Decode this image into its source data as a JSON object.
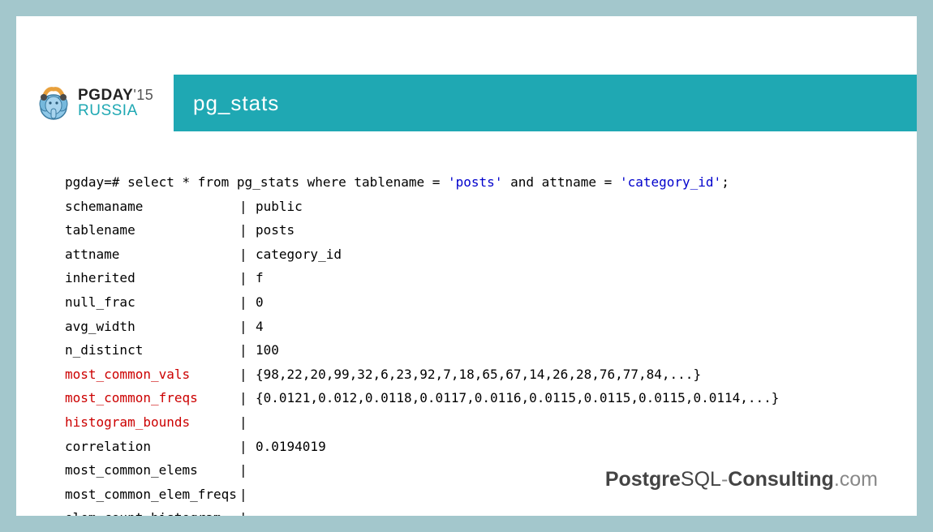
{
  "logo": {
    "line1_main": "PGDAY",
    "line1_sup": "'15",
    "line2": "RUSSIA"
  },
  "title": "pg_stats",
  "query": {
    "prefix": "pgday=# ",
    "body1": "select * from pg_stats where tablename = ",
    "lit1": "'posts'",
    "body2": " and attname = ",
    "lit2": "'category_id'",
    "tail": ";"
  },
  "rows": [
    {
      "k": "schemaname",
      "v": "public",
      "red": false
    },
    {
      "k": "tablename",
      "v": "posts",
      "red": false
    },
    {
      "k": "attname",
      "v": "category_id",
      "red": false
    },
    {
      "k": "inherited",
      "v": "f",
      "red": false
    },
    {
      "k": "null_frac",
      "v": "0",
      "red": false
    },
    {
      "k": "avg_width",
      "v": "4",
      "red": false
    },
    {
      "k": "n_distinct",
      "v": "100",
      "red": false
    },
    {
      "k": "most_common_vals",
      "v": "{98,22,20,99,32,6,23,92,7,18,65,67,14,26,28,76,77,84,...}",
      "red": true
    },
    {
      "k": "most_common_freqs",
      "v": "{0.0121,0.012,0.0118,0.0117,0.0116,0.0115,0.0115,0.0115,0.0114,...}",
      "red": true
    },
    {
      "k": "histogram_bounds",
      "v": "",
      "red": true
    },
    {
      "k": "correlation",
      "v": "0.0194019",
      "red": false
    },
    {
      "k": "most_common_elems",
      "v": "",
      "red": false
    },
    {
      "k": "most_common_elem_freqs",
      "v": "",
      "red": false
    },
    {
      "k": "elem_count_histogram",
      "v": "",
      "red": false
    }
  ],
  "footer": {
    "p1": "Postgre",
    "p2": "SQL",
    "dash": "-",
    "p3": "Consulting",
    "dot": ".",
    "p4": "com"
  }
}
